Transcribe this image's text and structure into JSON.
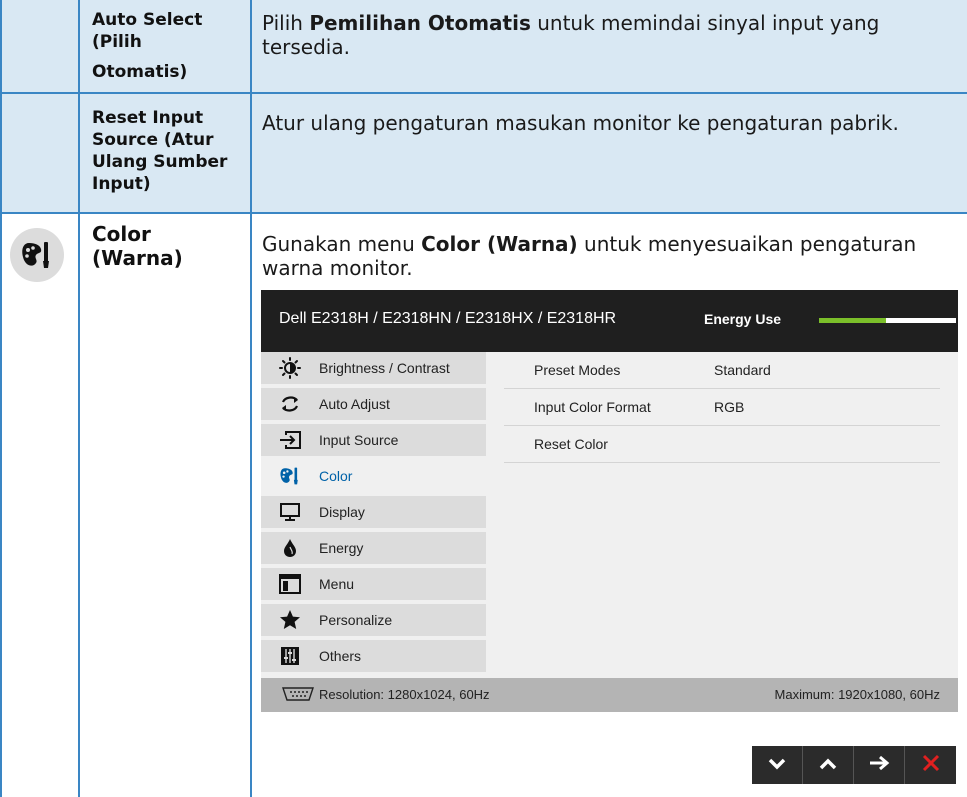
{
  "rows": {
    "auto_select": {
      "label_lines": [
        "Auto Select",
        "(Pilih",
        "Otomatis)"
      ],
      "desc_prefix": "Pilih ",
      "desc_bold": "Pemilihan Otomatis",
      "desc_suffix_line1": " untuk memindai sinyal input yang",
      "desc_line2": "tersedia."
    },
    "reset_input": {
      "label_lines": [
        "Reset Input",
        "Source (Atur",
        "Ulang Sumber",
        "Input)"
      ],
      "desc": "Atur ulang pengaturan masukan monitor ke pengaturan pabrik."
    },
    "color": {
      "label_lines": [
        "Color",
        "(Warna)"
      ],
      "desc_prefix": "Gunakan menu ",
      "desc_bold": "Color (Warna)",
      "desc_suffix_line1": " untuk menyesuaikan pengaturan",
      "desc_line2": "warna monitor.",
      "icon": "color-palette-icon"
    }
  },
  "osd": {
    "model": "Dell E2318H / E2318HN / E2318HX / E2318HR",
    "energy_label": "Energy Use",
    "energy_level": 0.49,
    "menu": [
      {
        "label": "Brightness / Contrast",
        "icon": "brightness-icon"
      },
      {
        "label": "Auto Adjust",
        "icon": "auto-adjust-icon"
      },
      {
        "label": "Input Source",
        "icon": "input-source-icon"
      },
      {
        "label": "Color",
        "icon": "color-icon"
      },
      {
        "label": "Display",
        "icon": "display-icon"
      },
      {
        "label": "Energy",
        "icon": "energy-icon"
      },
      {
        "label": "Menu",
        "icon": "menu-icon"
      },
      {
        "label": "Personalize",
        "icon": "star-icon"
      },
      {
        "label": "Others",
        "icon": "others-icon"
      }
    ],
    "active_menu": "Color",
    "panel": [
      {
        "label": "Preset Modes",
        "value": "Standard"
      },
      {
        "label": "Input Color Format",
        "value": "RGB"
      },
      {
        "label": "Reset Color",
        "value": ""
      }
    ],
    "footer_resolution": "Resolution: 1280x1024, 60Hz",
    "footer_maximum": "Maximum: 1920x1080, 60Hz"
  },
  "nav_buttons": [
    "chevron-down-icon",
    "chevron-up-icon",
    "arrow-right-icon",
    "close-icon"
  ],
  "colors": {
    "row_background": "#d9e8f3",
    "grid_lines": "#3a86c4",
    "energy_green": "#7bbf2a",
    "close_red": "#e02020",
    "active_menu_text": "#0062a8"
  }
}
